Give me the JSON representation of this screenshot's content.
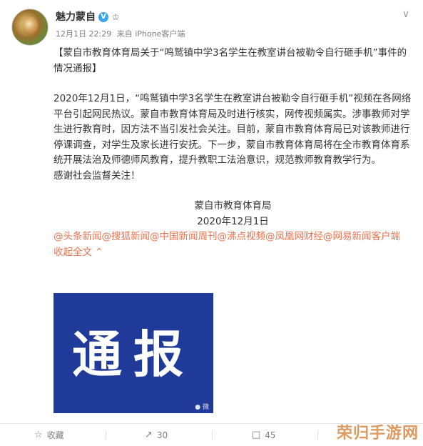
{
  "author": {
    "name": "魅力蒙自",
    "verified_mark": "V",
    "badge_symbol": "♔"
  },
  "meta": {
    "datetime": "12月1日 22:29",
    "source": "来自 iPhone客户端"
  },
  "post": {
    "title": "【蒙自市教育体育局关于“鸣鹫镇中学3名学生在教室讲台被勒令自行砸手机”事件的情况通报】",
    "body": "2020年12月1日，“鸣鹫镇中学3名学生在教室讲台被勒令自行砸手机”视频在各网络平台引起网民热议。蒙自市教育体育局及时进行核实，网传视频属实。涉事教师对学生进行教育时，因方法不当引发社会关注。目前，蒙自市教育体育局已对该教师进行停课调查，对学生及家长进行安抚。下一步，蒙自市教育体育局将在全市教育体育系统开展法治及师德师风教育，提升教职工法治意识，规范教师教育教学行为。",
    "thanks": "感谢社会监督关注！",
    "signature_org": "蒙自市教育体育局",
    "signature_date": "2020年12月1日",
    "mentions": [
      "@头条新闻",
      "@搜狐新闻",
      "@中国新闻周刊",
      "@沸点视频",
      "@凤凰网财经",
      "@网易新闻客户端"
    ],
    "collapse_label": "收起全文",
    "collapse_icon": "chevron-up-icon"
  },
  "image": {
    "text": "通报",
    "background_color": "#1f3a99",
    "watermark": "微"
  },
  "toolbar": {
    "favorite_label": "收藏",
    "forward_count": "30",
    "comment_count": "45"
  },
  "site_watermark": "荣归手游网",
  "colors": {
    "link": "#eb7350",
    "verified": "#3ba3e8",
    "text": "#333333",
    "meta": "#808080"
  }
}
